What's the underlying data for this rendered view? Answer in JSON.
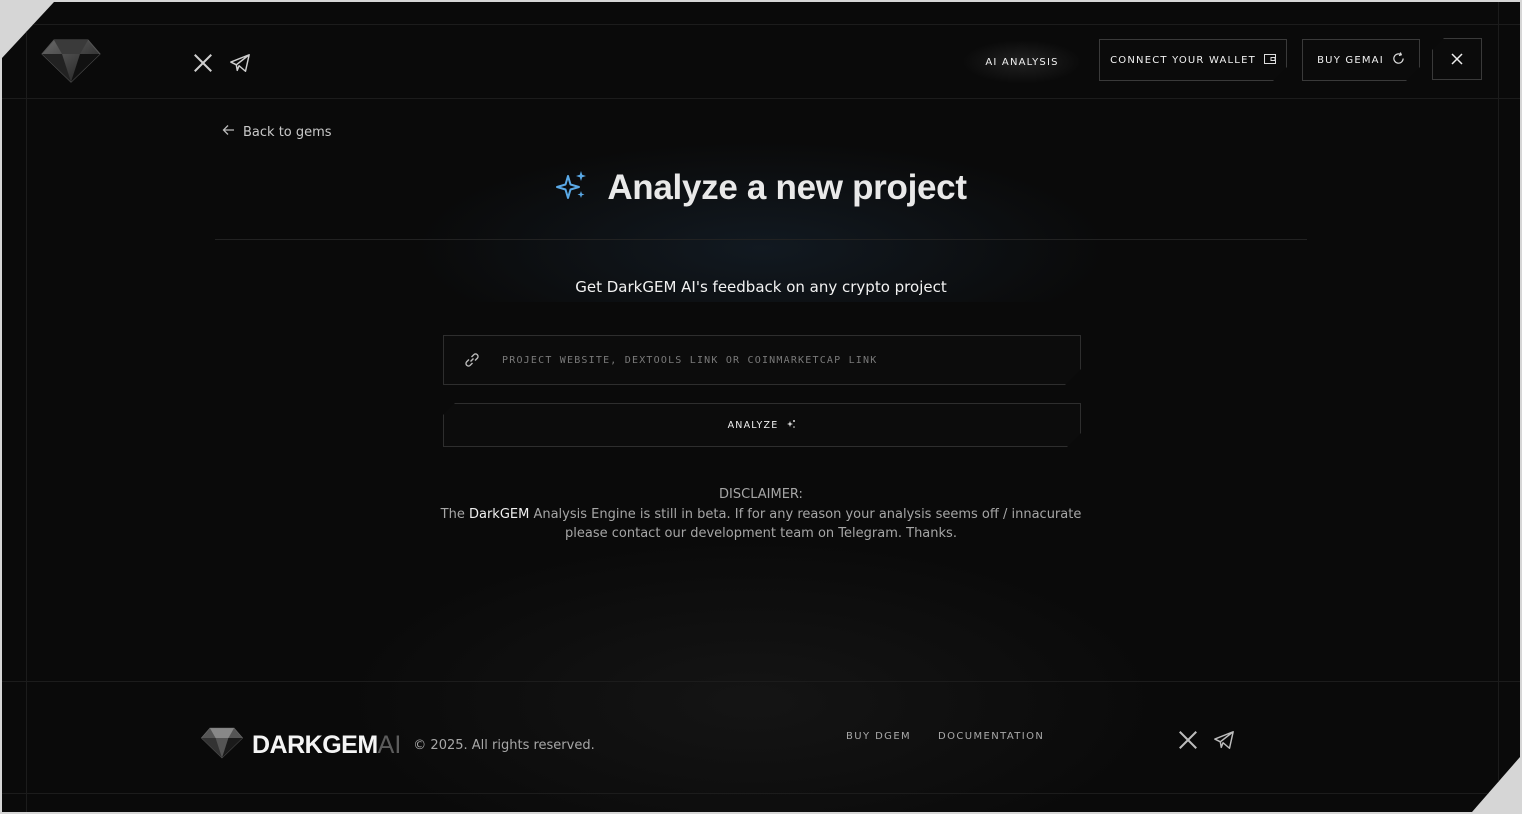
{
  "header": {
    "nav_ai_analysis": "AI ANALYSIS",
    "connect_wallet": "CONNECT YOUR WALLET",
    "buy_gemai": "BUY GEMAI"
  },
  "main": {
    "back_link": "Back to gems",
    "title": "Analyze a new project",
    "subtitle": "Get DarkGEM AI's feedback on any crypto project",
    "input_placeholder": "PROJECT WEBSITE, DEXTOOLS LINK OR COINMARKETCAP LINK",
    "input_value": "",
    "analyze_label": "ANALYZE",
    "disclaimer_title": "DISCLAIMER:",
    "disclaimer_prefix": "The ",
    "disclaimer_brand": "DarkGEM",
    "disclaimer_line1_rest": " Analysis Engine is still in beta. If for any reason your analysis seems off / innacurate",
    "disclaimer_line2": "please contact our development team on Telegram. Thanks."
  },
  "footer": {
    "brand": "DARKGEM",
    "brand_suffix": "AI",
    "copyright": "© 2025. All rights reserved.",
    "links": [
      "BUY DGEM",
      "DOCUMENTATION"
    ]
  },
  "colors": {
    "background": "#0a0a0a",
    "border": "#2e2e2e",
    "accent_sparkle": "#5aa9e6"
  },
  "icons": [
    "diamond-logo-icon",
    "x-twitter-icon",
    "telegram-icon",
    "wallet-icon",
    "refresh-icon",
    "close-icon",
    "arrow-left-icon",
    "sparkles-icon",
    "link-icon"
  ]
}
